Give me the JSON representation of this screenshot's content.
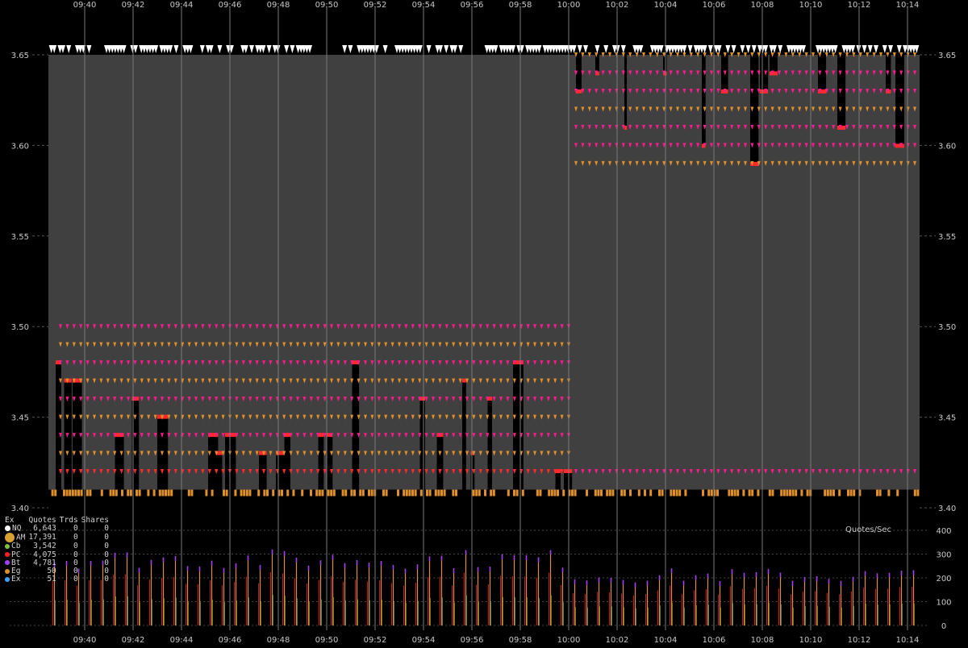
{
  "chart_data": [
    {
      "type": "area",
      "x_ticks": [
        "09:40",
        "09:42",
        "09:44",
        "09:46",
        "09:48",
        "09:50",
        "09:52",
        "09:54",
        "09:56",
        "09:58",
        "10:00",
        "10:02",
        "10:04",
        "10:06",
        "10:08",
        "10:10",
        "10:12",
        "10:14"
      ],
      "x_range": [
        "09:38:30",
        "10:14:30"
      ],
      "y_ticks": [
        "3.40",
        "3.45",
        "3.50",
        "3.55",
        "3.60",
        "3.65"
      ],
      "ylim": [
        3.4,
        3.65
      ],
      "grid": true,
      "nbbo_spread": {
        "segments": [
          {
            "from": "09:38:30",
            "to": "10:00:00",
            "bid": 3.41,
            "ask": 3.65
          },
          {
            "from": "10:00:00",
            "to": "10:14:30",
            "bid": 3.41,
            "ask": 3.65
          }
        ]
      },
      "quote_levels": {
        "before_1000": [
          3.42,
          3.43,
          3.44,
          3.45,
          3.46,
          3.47,
          3.48,
          3.49,
          3.5
        ],
        "after_1000_bid": [
          3.42
        ],
        "after_1000_ask": [
          3.59,
          3.6,
          3.61,
          3.62,
          3.63,
          3.64,
          3.65
        ]
      },
      "colors": {
        "bid_ask_spread": "#404040",
        "quote_marker": "#ff2a2a",
        "alt_marker": "#ff1a8c",
        "eg_marker": "#e0902a",
        "nq_marker": "#ffffff"
      }
    },
    {
      "type": "bar",
      "title": "Quotes/Sec",
      "y_ticks": [
        "0",
        "100",
        "200",
        "300",
        "400"
      ],
      "ylim": [
        0,
        400
      ],
      "typical_peak_before_1000": 280,
      "typical_peak_after_1000": 210,
      "colors": {
        "bar": "#e0902a",
        "peak": "#a040ff",
        "mid": "#ff2020"
      }
    }
  ],
  "legend": {
    "headers": {
      "ex": "Ex",
      "quotes": "Quotes",
      "trds": "Trds",
      "shares": "Shares"
    },
    "rows": [
      {
        "ex": "NQ",
        "quotes": "6,643",
        "trds": "0",
        "shares": "0",
        "color": "#ffffff",
        "size": 7
      },
      {
        "ex": "AM",
        "quotes": "17,391",
        "trds": "0",
        "shares": "0",
        "color": "#d8a030",
        "size": 12
      },
      {
        "ex": "Cb",
        "quotes": "3,542",
        "trds": "0",
        "shares": "0",
        "color": "#80c040",
        "size": 6
      },
      {
        "ex": "PC",
        "quotes": "4,075",
        "trds": "0",
        "shares": "0",
        "color": "#ff2020",
        "size": 6
      },
      {
        "ex": "Bt",
        "quotes": "4,781",
        "trds": "0",
        "shares": "0",
        "color": "#a040ff",
        "size": 6
      },
      {
        "ex": "Eg",
        "quotes": "50",
        "trds": "0",
        "shares": "0",
        "color": "#e0902a",
        "size": 6
      },
      {
        "ex": "Ex",
        "quotes": "51",
        "trds": "0",
        "shares": "0",
        "color": "#40a0ff",
        "size": 6
      }
    ]
  }
}
